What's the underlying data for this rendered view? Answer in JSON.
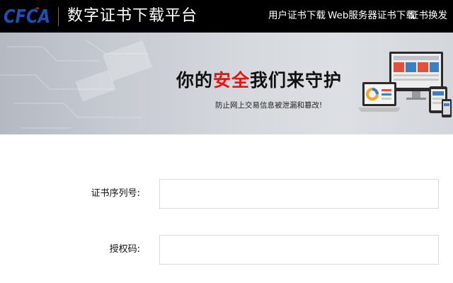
{
  "header": {
    "logo_text": "CFCA",
    "site_title": "数字证书下载平台",
    "nav": [
      {
        "label": "用户证书下载"
      },
      {
        "label": "Web服务器证书下载"
      },
      {
        "label": "证书换发"
      }
    ]
  },
  "banner": {
    "heading_before": "你的",
    "heading_highlight": "安全",
    "heading_after": "我们来守护",
    "subtitle": "防止网上交易信息被泄漏和篡改!",
    "highlight_color": "#e8150f"
  },
  "form": {
    "serial_label": "证书序列号:",
    "serial_value": "",
    "auth_label": "授权码:",
    "auth_value": ""
  },
  "colors": {
    "header_bg": "#000000",
    "logo_blue": "#1e4fb8",
    "banner_bg": "#d6d9de"
  }
}
